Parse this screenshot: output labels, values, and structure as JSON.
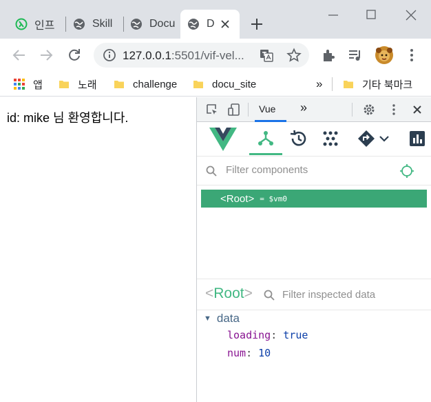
{
  "tabs": [
    {
      "label": "인프",
      "icon": "inflearn-icon"
    },
    {
      "label": "Skill",
      "icon": "globe-icon"
    },
    {
      "label": "Docu",
      "icon": "globe-icon"
    },
    {
      "label": "D",
      "icon": "globe-icon",
      "active": true
    }
  ],
  "address": {
    "host": "127.0.0.1",
    "rest": ":5501/vif-vel..."
  },
  "bookmarks": [
    {
      "label": "앱",
      "icon": "apps-grid-icon"
    },
    {
      "label": "노래",
      "icon": "folder-icon"
    },
    {
      "label": "challenge",
      "icon": "folder-icon"
    },
    {
      "label": "docu_site",
      "icon": "folder-icon"
    }
  ],
  "bookmarks_overflow": "»",
  "other_bookmarks": "기타 북마크",
  "page": {
    "text": "id: mike 님 환영합니다."
  },
  "devtools": {
    "active_tab": "Vue",
    "more_tabs": "»",
    "filter_placeholder": "Filter components",
    "root_tag": "<Root>",
    "root_ref": "= $vm0",
    "inspect": {
      "open": "<",
      "name": "Root",
      "close": ">",
      "filter_placeholder": "Filter inspected data"
    },
    "section": "data",
    "props": [
      {
        "key": "loading",
        "value": "true"
      },
      {
        "key": "num",
        "value": "10"
      }
    ]
  },
  "colors": {
    "vue_green": "#42b883",
    "selection_green": "#3ba776",
    "chrome_accent": "#1a73e8"
  }
}
